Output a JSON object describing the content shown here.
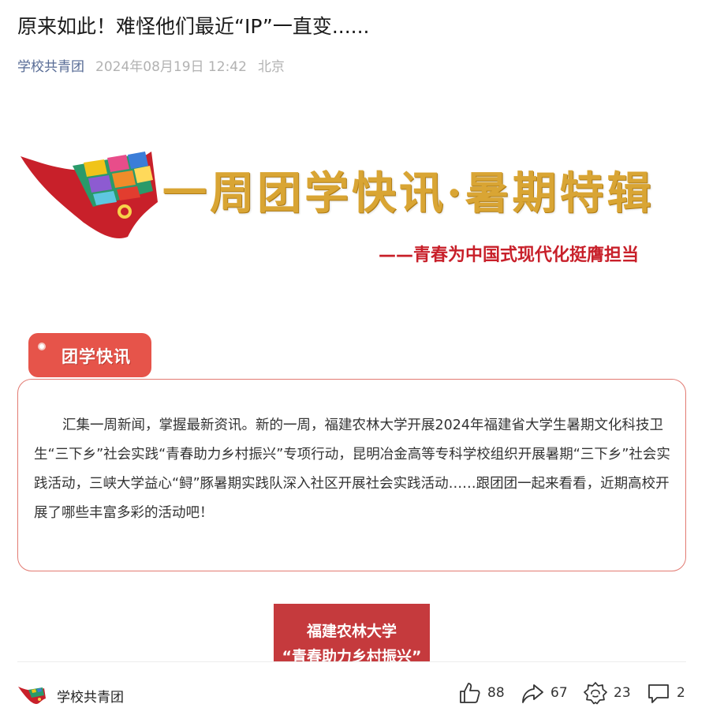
{
  "article": {
    "title": "原来如此！难怪他们最近“IP”一直变......",
    "account": "学校共青团",
    "date": "2024年08月19日 12:42",
    "location": "北京"
  },
  "banner": {
    "title": "一周团学快讯·暑期特辑",
    "subtitle": "——青春为中国式现代化挺膺担当"
  },
  "section": {
    "tag_label": "团学快讯",
    "intro": "汇集一周新闻，掌握最新资讯。新的一周，福建农林大学开展2024年福建省大学生暑期文化科技卫生“三下乡”社会实践“青春助力乡村振兴”专项行动，昆明冶金高等专科学校组织开展暑期“三下乡”社会实践活动，三峡大学益心“鲟”豚暑期实践队深入社区开展社会实践活动……跟团团一起来看看，近期高校开展了哪些丰富多彩的活动吧！"
  },
  "next_block": {
    "line1": "福建农林大学",
    "line2": "“青春助力乡村振兴”"
  },
  "footer": {
    "account": "学校共青团",
    "like_count": "88",
    "share_count": "67",
    "favorite_count": "23",
    "comment_count": "2"
  },
  "colors": {
    "accent_red": "#e6544a",
    "account_blue": "#576b95",
    "gold": "#d9a534"
  },
  "icons": [
    "thumbs-up-icon",
    "share-icon",
    "favorite-icon",
    "comment-icon",
    "youth-league-logo"
  ]
}
